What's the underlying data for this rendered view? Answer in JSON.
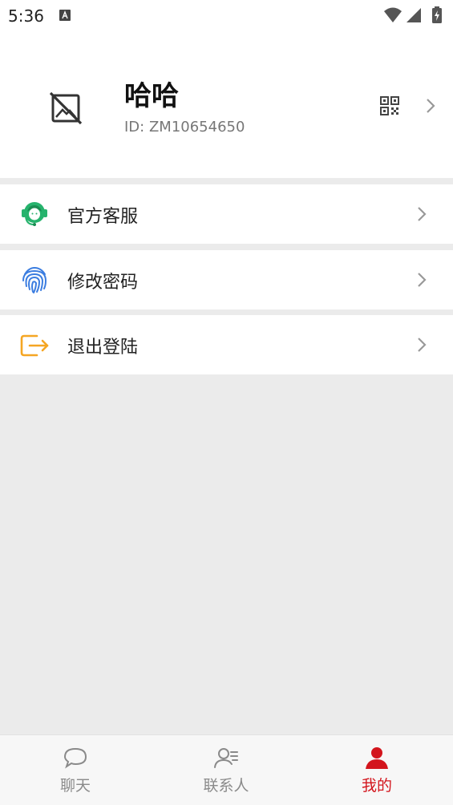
{
  "status_bar": {
    "time": "5:36"
  },
  "profile": {
    "name": "哈哈",
    "id_text": "ID: ZM10654650"
  },
  "menu": [
    {
      "label": "官方客服",
      "icon": "customer-service-icon",
      "color": "#26b36d"
    },
    {
      "label": "修改密码",
      "icon": "fingerprint-icon",
      "color": "#3b7de0"
    },
    {
      "label": "退出登陆",
      "icon": "logout-icon",
      "color": "#f5a623"
    }
  ],
  "tabs": [
    {
      "label": "聊天",
      "icon": "chat-bubble-icon",
      "active": false
    },
    {
      "label": "联系人",
      "icon": "contacts-icon",
      "active": false
    },
    {
      "label": "我的",
      "icon": "person-icon",
      "active": true
    }
  ],
  "colors": {
    "accent": "#d3151d",
    "inactive": "#8a8a8a",
    "background": "#ebebeb"
  }
}
